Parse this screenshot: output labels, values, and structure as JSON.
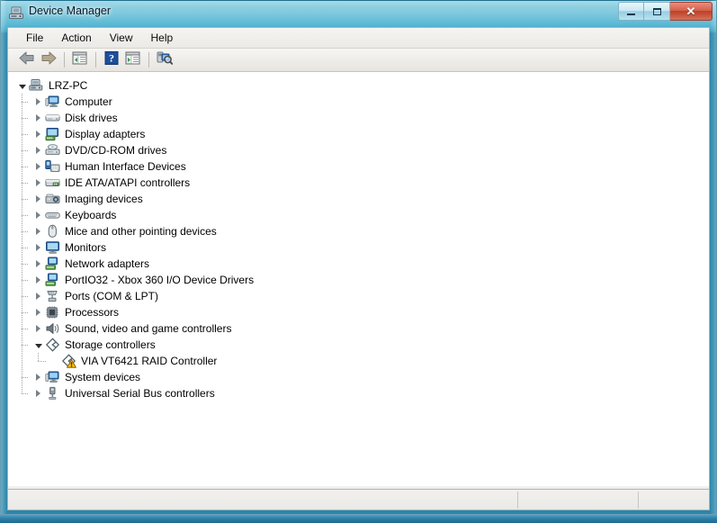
{
  "window": {
    "title": "Device Manager",
    "title_icon": "device-manager-icon",
    "controls": {
      "minimize": "Minimize",
      "maximize": "Maximize",
      "close": "Close"
    }
  },
  "menubar": {
    "items": [
      {
        "label": "File"
      },
      {
        "label": "Action"
      },
      {
        "label": "View"
      },
      {
        "label": "Help"
      }
    ]
  },
  "toolbar": {
    "buttons": [
      {
        "name": "back-button",
        "icon": "back-arrow-icon",
        "tooltip": "Back"
      },
      {
        "name": "forward-button",
        "icon": "forward-arrow-icon",
        "tooltip": "Forward"
      },
      {
        "name": "show-hide-console-tree-button",
        "icon": "console-tree-icon",
        "tooltip": "Show/Hide Console Tree"
      },
      {
        "name": "help-button",
        "icon": "help-question-icon",
        "tooltip": "Help"
      },
      {
        "name": "properties-button",
        "icon": "properties-window-icon",
        "tooltip": "Properties"
      },
      {
        "name": "scan-hardware-changes-button",
        "icon": "scan-hardware-icon",
        "tooltip": "Scan for hardware changes"
      }
    ]
  },
  "tree": {
    "root": {
      "label": "LRZ-PC",
      "icon": "computer-root-icon",
      "expanded": true
    },
    "items": [
      {
        "label": "Computer",
        "icon": "computer-icon",
        "expanded": false,
        "level": 1,
        "warning": false
      },
      {
        "label": "Disk drives",
        "icon": "disk-drive-icon",
        "expanded": false,
        "level": 1,
        "warning": false
      },
      {
        "label": "Display adapters",
        "icon": "display-adapter-icon",
        "expanded": false,
        "level": 1,
        "warning": false
      },
      {
        "label": "DVD/CD-ROM drives",
        "icon": "dvd-drive-icon",
        "expanded": false,
        "level": 1,
        "warning": false
      },
      {
        "label": "Human Interface Devices",
        "icon": "hid-icon",
        "expanded": false,
        "level": 1,
        "warning": false
      },
      {
        "label": "IDE ATA/ATAPI controllers",
        "icon": "ide-controller-icon",
        "expanded": false,
        "level": 1,
        "warning": false
      },
      {
        "label": "Imaging devices",
        "icon": "imaging-device-icon",
        "expanded": false,
        "level": 1,
        "warning": false
      },
      {
        "label": "Keyboards",
        "icon": "keyboard-icon",
        "expanded": false,
        "level": 1,
        "warning": false
      },
      {
        "label": "Mice and other pointing devices",
        "icon": "mouse-icon",
        "expanded": false,
        "level": 1,
        "warning": false
      },
      {
        "label": "Monitors",
        "icon": "monitor-icon",
        "expanded": false,
        "level": 1,
        "warning": false
      },
      {
        "label": "Network adapters",
        "icon": "network-adapter-icon",
        "expanded": false,
        "level": 1,
        "warning": false
      },
      {
        "label": "PortIO32 - Xbox 360 I/O Device Drivers",
        "icon": "network-adapter-icon",
        "expanded": false,
        "level": 1,
        "warning": false
      },
      {
        "label": "Ports (COM & LPT)",
        "icon": "port-icon",
        "expanded": false,
        "level": 1,
        "warning": false
      },
      {
        "label": "Processors",
        "icon": "processor-icon",
        "expanded": false,
        "level": 1,
        "warning": false
      },
      {
        "label": "Sound, video and game controllers",
        "icon": "sound-controller-icon",
        "expanded": false,
        "level": 1,
        "warning": false
      },
      {
        "label": "Storage controllers",
        "icon": "storage-controller-icon",
        "expanded": true,
        "level": 1,
        "warning": false
      },
      {
        "label": "VIA VT6421 RAID Controller",
        "icon": "storage-controller-icon",
        "expanded": null,
        "level": 2,
        "warning": true
      },
      {
        "label": "System devices",
        "icon": "system-device-icon",
        "expanded": false,
        "level": 1,
        "warning": false
      },
      {
        "label": "Universal Serial Bus controllers",
        "icon": "usb-controller-icon",
        "expanded": false,
        "level": 1,
        "warning": false
      }
    ]
  },
  "statusbar": {
    "text": "",
    "segments": [
      {
        "name": "status-segment-main",
        "text": ""
      },
      {
        "name": "status-segment-2",
        "text": ""
      },
      {
        "name": "status-segment-3",
        "text": ""
      }
    ]
  },
  "colors": {
    "accent": "#2e90b4",
    "close_button": "#bd4026",
    "warning_badge": "#ffc20e",
    "tree_background": "#ffffff"
  }
}
